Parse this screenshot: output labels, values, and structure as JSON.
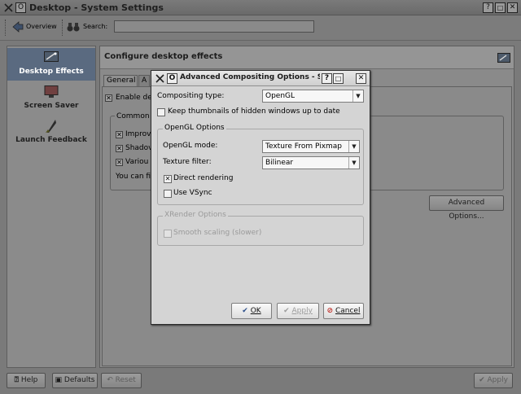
{
  "window": {
    "title": "Desktop - System Settings",
    "app_icon": "O",
    "buttons": {
      "help": "?",
      "maximize": "□",
      "close": "✕"
    }
  },
  "toolbar": {
    "overview": "Overview",
    "search_label": "Search:",
    "search_value": ""
  },
  "sidebar": {
    "items": [
      {
        "label": "Desktop Effects",
        "selected": true,
        "icon": "desktop-effects-icon"
      },
      {
        "label": "Screen Saver",
        "selected": false,
        "icon": "screen-saver-icon"
      },
      {
        "label": "Launch Feedback",
        "selected": false,
        "icon": "rocket-icon"
      }
    ]
  },
  "content": {
    "header": "Configure desktop effects",
    "tabs": [
      "General",
      "A"
    ],
    "enable_effects": "Enable de",
    "common_title": "Common",
    "options": [
      "Improv",
      "Shadov",
      "Variou"
    ],
    "find_text": "You can fi",
    "advanced_button": "Advanced Options..."
  },
  "bottom": {
    "help": "Help",
    "defaults": "Defaults",
    "reset": "Reset",
    "apply": "Apply"
  },
  "dialog": {
    "title": "Advanced Compositing Options - Sys",
    "compositing_label": "Compositing type:",
    "compositing_value": "OpenGL",
    "keep_thumbnails": "Keep thumbnails of hidden windows up to date",
    "keep_thumbnails_checked": false,
    "opengl_group": "OpenGL Options",
    "opengl_mode_label": "OpenGL mode:",
    "opengl_mode_value": "Texture From Pixmap",
    "texture_filter_label": "Texture filter:",
    "texture_filter_value": "Bilinear",
    "direct_rendering": "Direct rendering",
    "direct_rendering_checked": true,
    "use_vsync": "Use VSync",
    "use_vsync_checked": false,
    "xrender_group": "XRender Options",
    "smooth_scaling": "Smooth scaling (slower)",
    "smooth_scaling_checked": false,
    "ok": "OK",
    "apply": "Apply",
    "cancel": "Cancel"
  },
  "colors": {
    "selection": "#5a6a80",
    "dialog_bg": "#d4d4d4",
    "cancel_icon": "#c0302a",
    "ok_icon": "#2c4f8a"
  }
}
